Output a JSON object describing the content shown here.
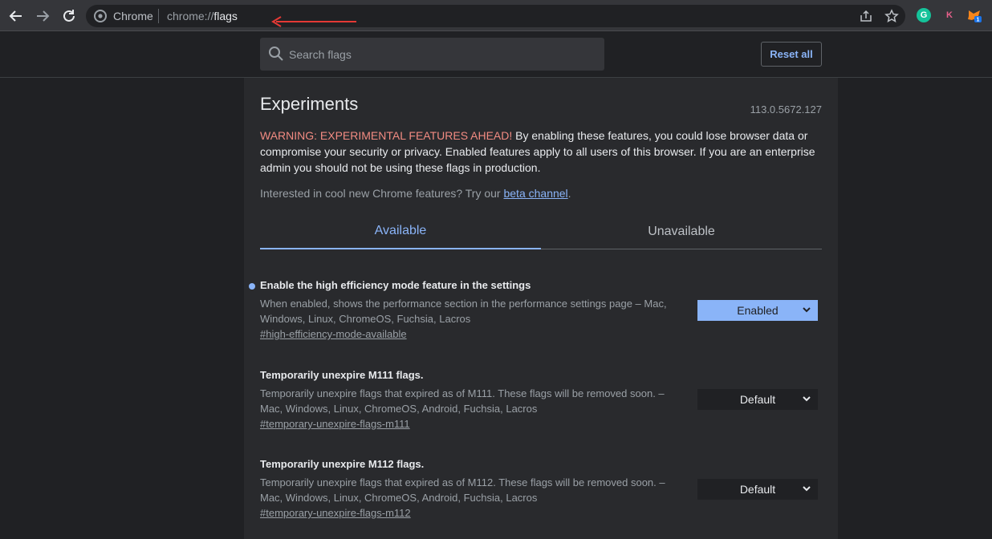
{
  "browser": {
    "site_label": "Chrome",
    "url_scheme": "chrome://",
    "url_path": "flags",
    "extensions": [
      {
        "name": "grammarly-icon",
        "letter": "G",
        "color": "#15c39a"
      },
      {
        "name": "k-extension-icon",
        "letter": "K",
        "color": "#e8608b"
      },
      {
        "name": "metamask-icon",
        "badge": "1",
        "color": "#f6851b"
      }
    ]
  },
  "header": {
    "search_placeholder": "Search flags",
    "reset_label": "Reset all"
  },
  "page": {
    "title": "Experiments",
    "version": "113.0.5672.127",
    "warning_label": "WARNING: EXPERIMENTAL FEATURES AHEAD!",
    "warning_text": " By enabling these features, you could lose browser data or compromise your security or privacy. Enabled features apply to all users of this browser. If you are an enterprise admin you should not be using these flags in production.",
    "interest_text": "Interested in cool new Chrome features? Try our ",
    "interest_link": "beta channel",
    "interest_end": "."
  },
  "tabs": {
    "available": "Available",
    "unavailable": "Unavailable"
  },
  "flags": [
    {
      "title": "Enable the high efficiency mode feature in the settings",
      "description": "When enabled, shows the performance section in the performance settings page – Mac, Windows, Linux, ChromeOS, Fuchsia, Lacros",
      "link": "#high-efficiency-mode-available",
      "state": "Enabled"
    },
    {
      "title": "Temporarily unexpire M111 flags.",
      "description": "Temporarily unexpire flags that expired as of M111. These flags will be removed soon. – Mac, Windows, Linux, ChromeOS, Android, Fuchsia, Lacros",
      "link": "#temporary-unexpire-flags-m111",
      "state": "Default"
    },
    {
      "title": "Temporarily unexpire M112 flags.",
      "description": "Temporarily unexpire flags that expired as of M112. These flags will be removed soon. – Mac, Windows, Linux, ChromeOS, Android, Fuchsia, Lacros",
      "link": "#temporary-unexpire-flags-m112",
      "state": "Default"
    }
  ]
}
